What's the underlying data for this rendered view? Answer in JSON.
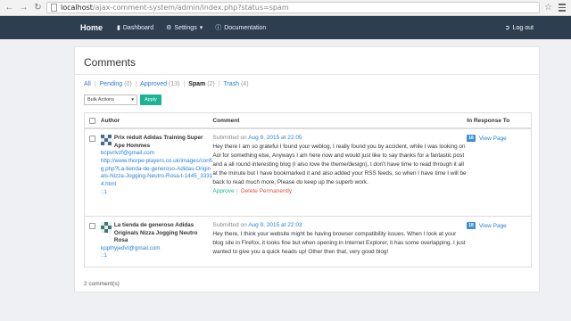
{
  "browser": {
    "url_host": "localhost",
    "url_path": "/ajax-comment-system/admin/index.php?status=spam"
  },
  "navbar": {
    "brand": "Home",
    "items": [
      {
        "label": "Dashboard",
        "icon": "comment-icon"
      },
      {
        "label": "Settings",
        "icon": "gear-icon"
      },
      {
        "label": "Documentation",
        "icon": "info-icon"
      }
    ],
    "logout": "Log out"
  },
  "page": {
    "title": "Comments",
    "filters": [
      {
        "label": "All",
        "count": ""
      },
      {
        "label": "Pending",
        "count": "(0)"
      },
      {
        "label": "Approved",
        "count": "(13)"
      },
      {
        "label": "Spam",
        "count": "(2)"
      },
      {
        "label": "Trash",
        "count": "(4)"
      }
    ],
    "bulk_actions": {
      "selected": "Bulk Actions",
      "apply": "Apply"
    },
    "table": {
      "headers": {
        "author": "Author",
        "comment": "Comment",
        "response": "In Response To"
      }
    },
    "comments": [
      {
        "author_name": "Prix réduit Adidas Training Super Ape Hommes",
        "email": "bcpvrlvzf@gmail.com",
        "website": "http://www.thorpe-players.co.uk/images/config.php?La-tienda-de-generoso-Adidas-Originals-Nizza-Jogging-Neutro-Rosa-t-1445_33314.html",
        "ip": "::1",
        "submitted_prefix": "Submitted on",
        "submitted_date": "Aug 9, 2015 at 22:05",
        "text": "Hey there I am so grateful I found your weblog, I really found you by accident, while I was looking on Aol for something else, Anyways I am here now and would just like to say thanks for a fantastic post and a all round interesting blog (I also love the theme/design), I don't have time to read through it all at the minute but I have bookmarked it and also added your RSS feeds, so when I have time I will be back to read much more, Please do keep up the superb work.",
        "approve": "Approve",
        "delete": "Delete Permanently",
        "badge": "18",
        "view_page": "View Page"
      },
      {
        "author_name": "La tienda de generoso Adidas Originals Nizza Jogging Neutro Rosa",
        "email": "kpplhyjedvt@gmail.com",
        "ip": "::1",
        "submitted_prefix": "Submitted on",
        "submitted_date": "Aug 9, 2015 at 22:03",
        "text": "Hey there, I think your website might be having browser compatibility issues. When I look at your blog site in Firefox, it looks fine but when opening in Internet Explorer, it has some overlapping. I just wanted to give you a quick heads up! Other then that, very good blog!",
        "badge": "18",
        "view_page": "View Page"
      }
    ],
    "total": "2 comment(s)"
  }
}
